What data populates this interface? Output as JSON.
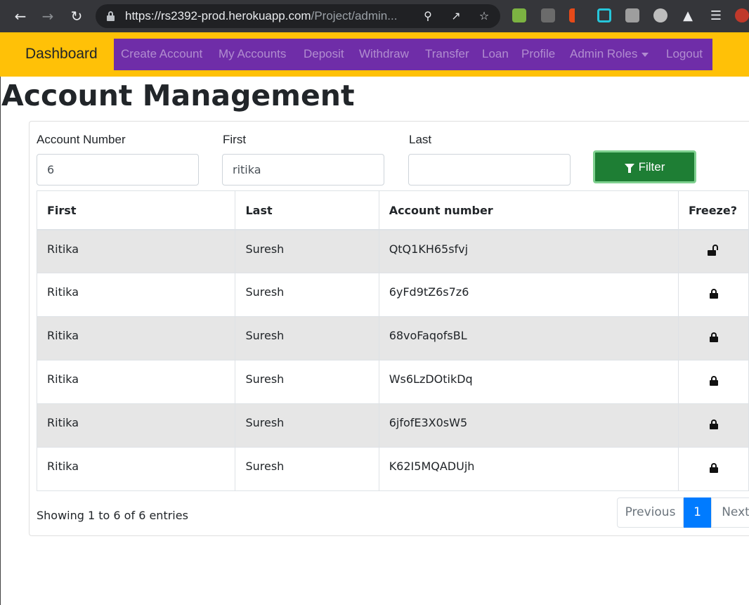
{
  "browser": {
    "url_host": "https://rs2392-prod.herokuapp.com",
    "url_path": "/Project/admin..."
  },
  "navbar": {
    "brand": "Dashboard",
    "items": [
      "Create Account",
      "My Accounts",
      "Deposit",
      "Withdraw",
      "Transfer",
      "Loan",
      "Profile",
      "Admin Roles",
      "Logout"
    ]
  },
  "page": {
    "title": "Account Management"
  },
  "filters": {
    "account_number_label": "Account Number",
    "account_number_value": "6",
    "first_label": "First",
    "first_value": "ritika",
    "last_label": "Last",
    "last_value": "",
    "filter_button": "Filter"
  },
  "table": {
    "headers": [
      "First",
      "Last",
      "Account number",
      "Freeze?"
    ],
    "rows": [
      {
        "first": "Ritika",
        "last": "Suresh",
        "account": "QtQ1KH65sfvj",
        "frozen": "unlocked"
      },
      {
        "first": "Ritika",
        "last": "Suresh",
        "account": "6yFd9tZ6s7z6",
        "frozen": "locked"
      },
      {
        "first": "Ritika",
        "last": "Suresh",
        "account": "68voFaqofsBL",
        "frozen": "locked"
      },
      {
        "first": "Ritika",
        "last": "Suresh",
        "account": "Ws6LzDOtikDq",
        "frozen": "locked"
      },
      {
        "first": "Ritika",
        "last": "Suresh",
        "account": "6jfofE3X0sW5",
        "frozen": "locked"
      },
      {
        "first": "Ritika",
        "last": "Suresh",
        "account": "K62I5MQADUjh",
        "frozen": "locked"
      }
    ]
  },
  "pagination": {
    "info": "Showing 1 to 6 of 6 entries",
    "previous": "Previous",
    "current": "1",
    "next": "Next"
  },
  "colors": {
    "navbar_bg": "#ffc107",
    "menu_bg": "#6f2da8",
    "filter_button": "#1e7e34",
    "active_page": "#007bff"
  }
}
